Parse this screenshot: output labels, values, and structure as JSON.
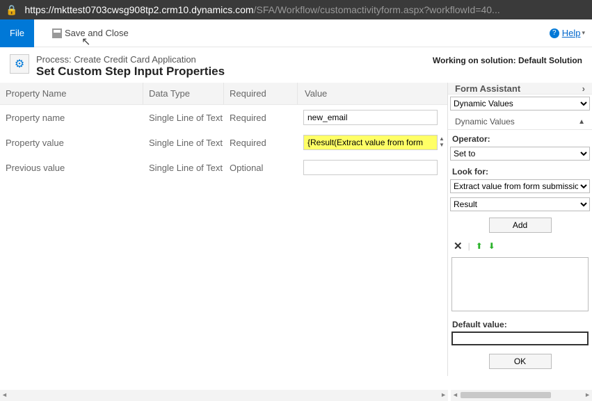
{
  "url": {
    "secure_host": "https://mkttest0703cwsg908tp2.crm10.dynamics.com",
    "path": "/SFA/Workflow/customactivityform.aspx?workflowId=40..."
  },
  "ribbon": {
    "file": "File",
    "save_close": "Save and Close",
    "help": "Help"
  },
  "header": {
    "process_prefix": "Process:",
    "process_name": "Create Credit Card Application",
    "page_title": "Set Custom Step Input Properties",
    "solution_label": "Working on solution:",
    "solution_name": "Default Solution"
  },
  "grid": {
    "headers": {
      "name": "Property Name",
      "type": "Data Type",
      "required": "Required",
      "value": "Value"
    },
    "rows": [
      {
        "name": "Property name",
        "type": "Single Line of Text",
        "required": "Required",
        "value": "new_email",
        "highlighted": false
      },
      {
        "name": "Property value",
        "type": "Single Line of Text",
        "required": "Required",
        "value": "{Result(Extract value from form",
        "highlighted": true
      },
      {
        "name": "Previous value",
        "type": "Single Line of Text",
        "required": "Optional",
        "value": "",
        "highlighted": false
      }
    ]
  },
  "assistant": {
    "title": "Form Assistant",
    "dynamic_values_label": "Dynamic Values",
    "dynamic_values_option": "Dynamic Values",
    "section_label": "Dynamic Values",
    "operator_label": "Operator:",
    "operator_value": "Set to",
    "lookfor_label": "Look for:",
    "entity_value": "Extract value from form submission",
    "attr_value": "Result",
    "add_label": "Add",
    "default_label": "Default value:",
    "ok_label": "OK"
  }
}
